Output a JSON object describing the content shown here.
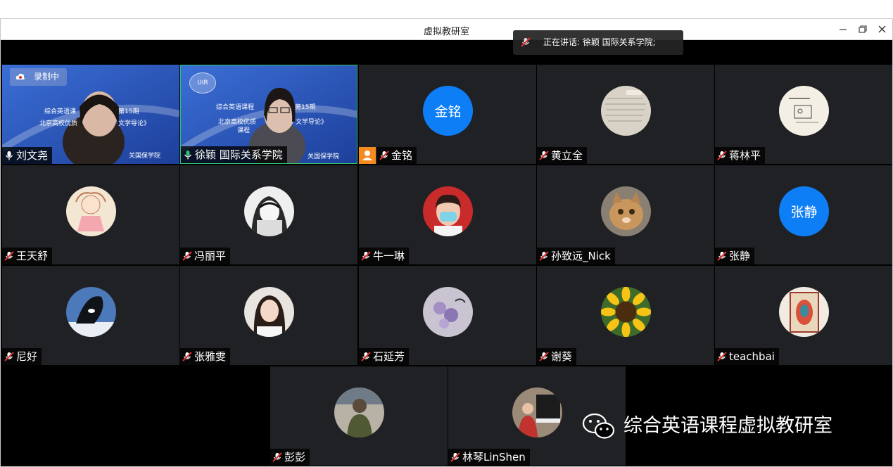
{
  "window": {
    "title": "虚拟教研室"
  },
  "recording": {
    "label": "录制中"
  },
  "speaking": {
    "label": "正在讲话: 徐颖 国际关系学院;"
  },
  "participants": [
    {
      "name": "刘文尧",
      "mic": "on",
      "kind": "video"
    },
    {
      "name": "徐颖 国际关系学院",
      "mic": "on-active",
      "kind": "video"
    },
    {
      "name": "金铭",
      "mic": "muted",
      "kind": "initials",
      "initials": "金铭",
      "host": true
    },
    {
      "name": "黄立全",
      "mic": "muted",
      "kind": "photo",
      "icon": "paper-photo-icon"
    },
    {
      "name": "蒋林平",
      "mic": "muted",
      "kind": "photo",
      "icon": "sketch-photo-icon"
    },
    {
      "name": "王天舒",
      "mic": "muted",
      "kind": "photo",
      "icon": "cartoon-girl-icon"
    },
    {
      "name": "冯丽平",
      "mic": "muted",
      "kind": "photo",
      "icon": "bw-girl-illustration-icon"
    },
    {
      "name": "牛一琳",
      "mic": "muted",
      "kind": "photo",
      "icon": "child-mask-photo-icon"
    },
    {
      "name": "孙致远_Nick",
      "mic": "muted",
      "kind": "photo",
      "icon": "cat-photo-icon"
    },
    {
      "name": "张静",
      "mic": "muted",
      "kind": "initials",
      "initials": "张静"
    },
    {
      "name": "尼好",
      "mic": "muted",
      "kind": "photo",
      "icon": "orca-photo-icon"
    },
    {
      "name": "张雅雯",
      "mic": "muted",
      "kind": "photo",
      "icon": "woman-portrait-icon"
    },
    {
      "name": "石延芳",
      "mic": "muted",
      "kind": "photo",
      "icon": "flower-bird-icon"
    },
    {
      "name": "谢葵",
      "mic": "muted",
      "kind": "photo",
      "icon": "sunflower-icon"
    },
    {
      "name": "teachbai",
      "mic": "muted",
      "kind": "photo",
      "icon": "folk-art-icon"
    },
    {
      "name": "彭彭",
      "mic": "muted",
      "kind": "photo",
      "icon": "person-back-photo-icon"
    },
    {
      "name": "林琴LinShen",
      "mic": "muted",
      "kind": "photo",
      "icon": "piano-child-photo-icon"
    }
  ],
  "shared_slide": {
    "line1a": "综合英语课",
    "line1b": "第15期",
    "line1c": "综合英语课程",
    "line2": "北京高校优质",
    "line2b": "文学导论》",
    "line3": "课程",
    "footer": "关国保学院",
    "logo": "UIR"
  },
  "watermark": {
    "label": "综合英语课程虚拟教研室",
    "icon": "wechat-icon"
  },
  "colors": {
    "tile_bg": "#202124",
    "avatar_blue": "#0e7ef6",
    "host_orange": "#f58a1f",
    "share_blue": "#2a52b8",
    "active_border": "#2fbf71"
  }
}
